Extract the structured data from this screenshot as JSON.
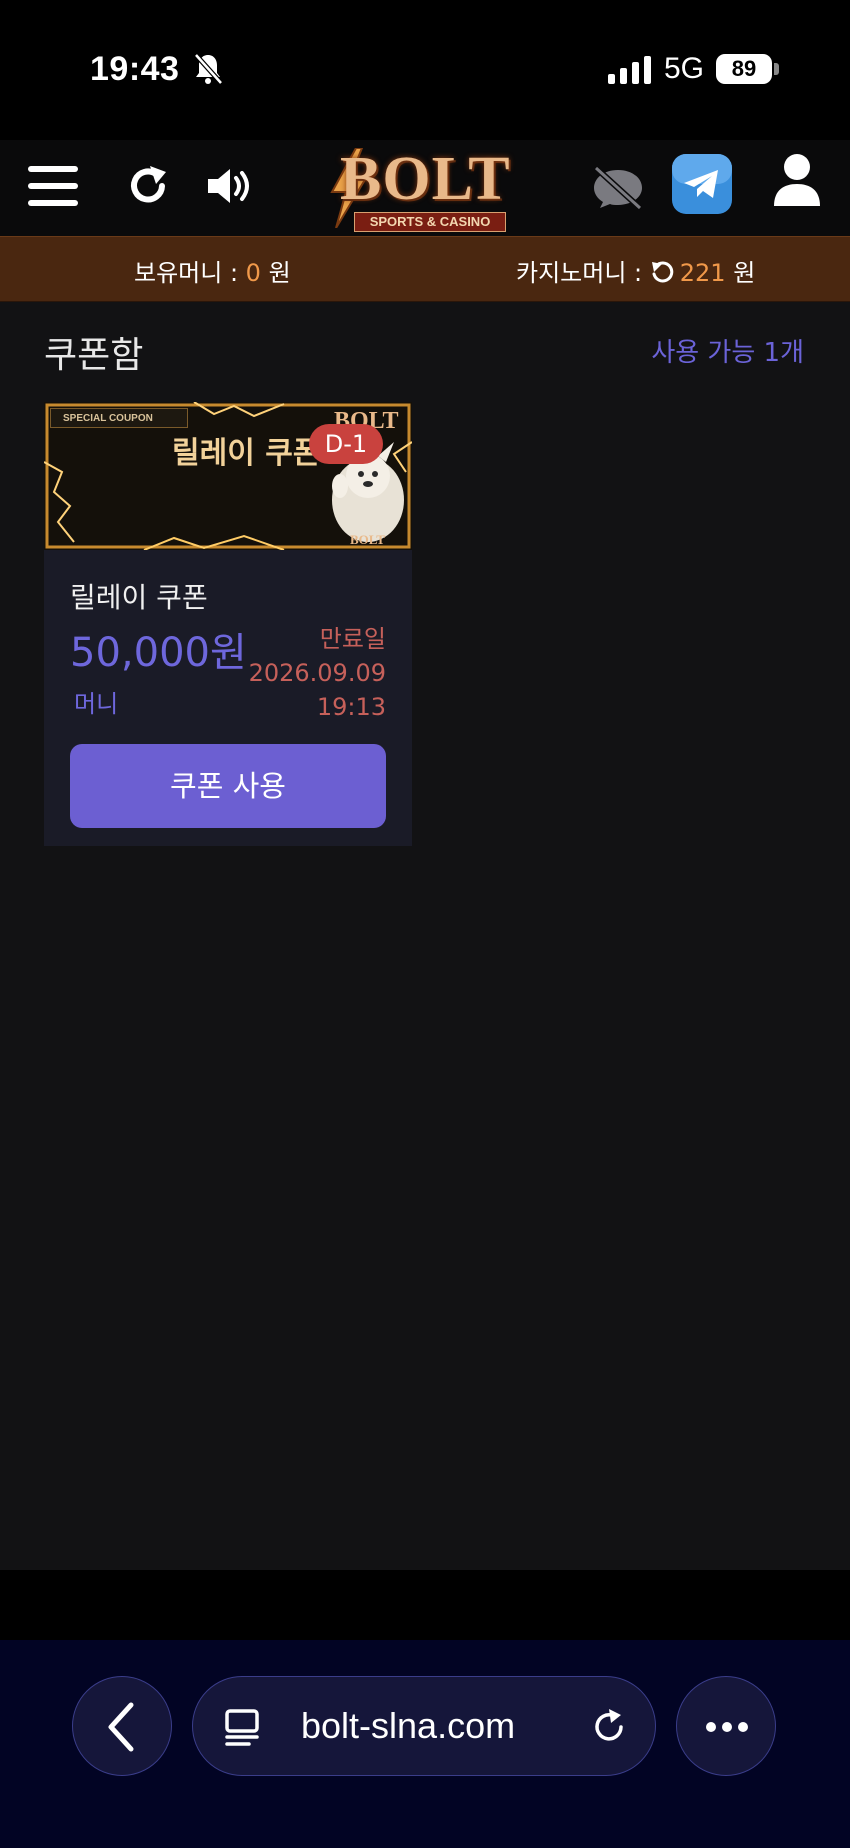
{
  "status_bar": {
    "time": "19:43",
    "network": "5G",
    "battery": "89"
  },
  "header": {
    "logo_text": "BOLT",
    "logo_sub": "SPORTS & CASINO"
  },
  "money_bar": {
    "holding_label": "보유머니 : ",
    "holding_value": "0",
    "holding_unit": " 원",
    "casino_label": "카지노머니 : ",
    "casino_value": "221",
    "casino_unit": " 원"
  },
  "page": {
    "title": "쿠폰함",
    "available": "사용 가능 1개"
  },
  "coupon": {
    "banner_special": "SPECIAL COUPON",
    "banner_title": "릴레이 쿠폰",
    "banner_logo": "BOLT",
    "d_badge": "D-1",
    "name": "릴레이 쿠폰",
    "amount": "50,000원",
    "unit": "머니",
    "expiry_label": "만료일",
    "expiry_date": "2026.09.09",
    "expiry_time": "19:13",
    "use_button": "쿠폰 사용"
  },
  "browser": {
    "url": "bolt-slna.com"
  },
  "colors": {
    "accent": "#6c5fd2",
    "orange": "#f1994a",
    "money_bar_bg": "#4a2710",
    "expiry_red": "#c6605a"
  }
}
